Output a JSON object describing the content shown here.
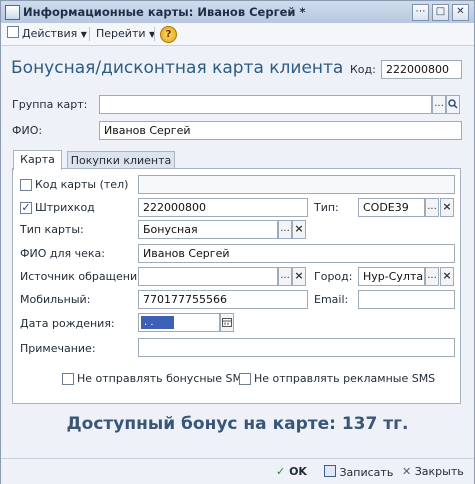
{
  "window": {
    "title": "Информационные карты: Иванов Сергей *"
  },
  "toolbar": {
    "actions_label": "Действия",
    "goto_label": "Перейти"
  },
  "form": {
    "heading": "Бонусная/дисконтная карта клиента",
    "code_label": "Код:",
    "code_value": "222000800",
    "group_label": "Группа карт:",
    "group_value": "",
    "fio_label": "ФИО:",
    "fio_value": "Иванов Сергей"
  },
  "tabs": [
    {
      "label": "Карта",
      "active": true
    },
    {
      "label": "Покупки клиента",
      "active": false
    }
  ],
  "card_tab": {
    "phone_code_label": "Код карты (тел)",
    "phone_code_checked": false,
    "phone_code_value": "",
    "barcode_label": "Штрихкод",
    "barcode_checked": true,
    "barcode_value": "222000800",
    "type_label": "Тип:",
    "type_value": "CODE39",
    "card_type_label": "Тип карты:",
    "card_type_value": "Бонусная",
    "receipt_name_label": "ФИО для чека:",
    "receipt_name_value": "Иванов Сергей",
    "source_label": "Источник обращения:",
    "source_value": "",
    "city_label": "Город:",
    "city_value": "Нур-Султан",
    "mobile_label": "Мобильный:",
    "mobile_value": "770177755566",
    "email_label": "Email:",
    "email_value": "",
    "birthdate_label": "Дата рождения:",
    "birthdate_value": ". .",
    "note_label": "Примечание:",
    "note_value": "",
    "no_bonus_sms_label": "Не отправлять бонусные SMS",
    "no_bonus_sms_checked": false,
    "no_ad_sms_label": "Не отправлять рекламные SMS",
    "no_ad_sms_checked": false
  },
  "bonus_text": "Доступный бонус на карте: 137 тг.",
  "footer": {
    "ok_label": "OK",
    "save_label": "Записать",
    "close_label": "Закрыть"
  }
}
